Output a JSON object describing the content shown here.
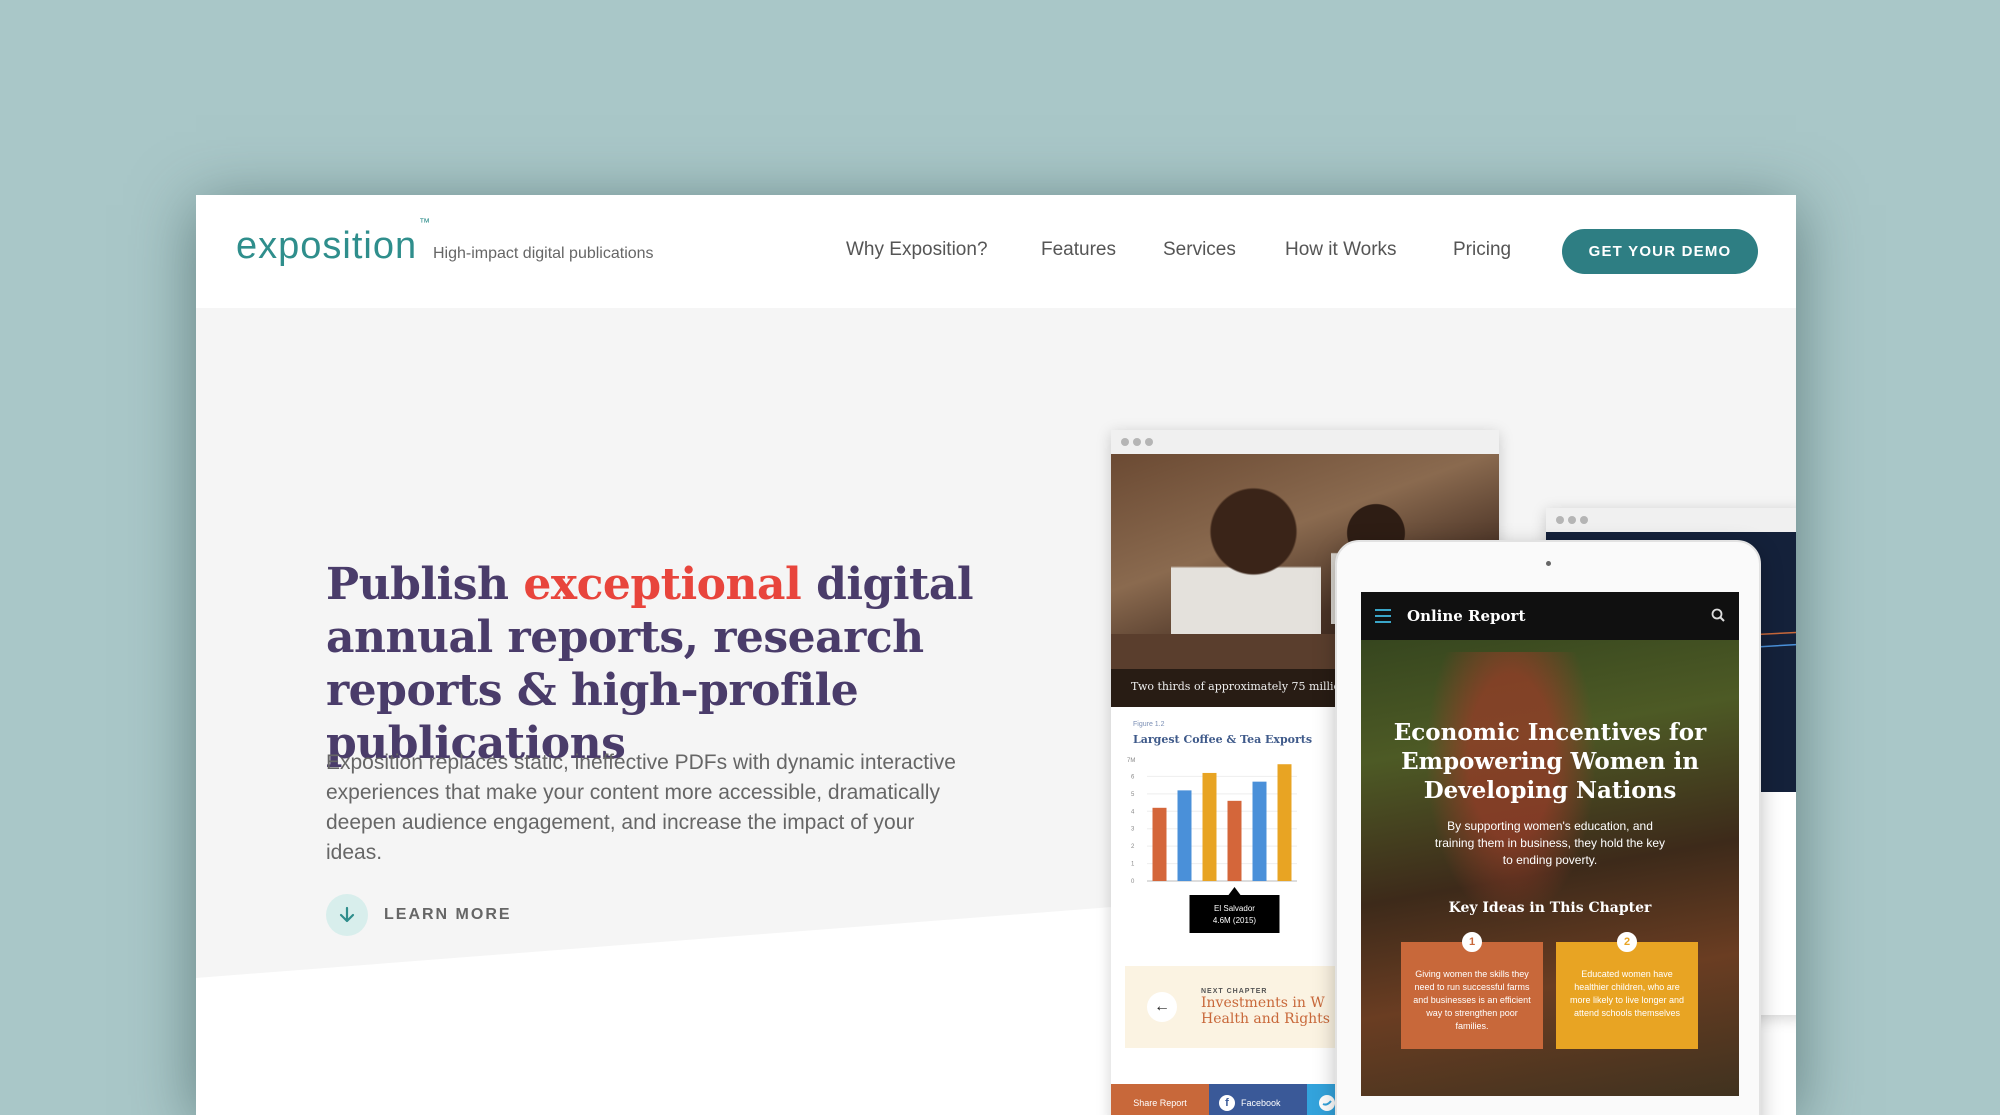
{
  "brand": {
    "logo": "exposition",
    "trademark": "™",
    "tagline": "High-impact digital publications"
  },
  "nav": {
    "items": [
      "Why Exposition?",
      "Features",
      "Services",
      "How it Works",
      "Pricing"
    ],
    "cta": "GET YOUR DEMO"
  },
  "hero": {
    "headline_before": "Publish ",
    "headline_accent": "exceptional",
    "headline_after": " digital annual reports, research reports & high-profile publications",
    "lead": "Exposition replaces static, ineffective PDFs with dynamic interactive experiences that make your content more accessible, dramatically deepen audience engagement, and increase the impact of your ideas.",
    "learn_more": "LEARN MORE"
  },
  "browser_mock": {
    "photo_caption": "Two thirds of approximately 75 million",
    "figure_label": "Figure 1.2",
    "figure_title": "Largest Coffee & Tea Exports",
    "tooltip_line1": "El Salvador",
    "tooltip_line2": "4.6M (2015)",
    "next_chapter_label": "NEXT CHAPTER",
    "next_chapter_line1": "Investments in W",
    "next_chapter_line2": "Health and Rights",
    "share_label": "Share Report",
    "facebook_label": "Facebook"
  },
  "chart_data": {
    "type": "bar",
    "title": "Largest Coffee & Tea Exports",
    "ylabel": "",
    "ylim": [
      0,
      7
    ],
    "yticks": [
      "0",
      "1",
      "2",
      "3",
      "4",
      "5",
      "6"
    ],
    "ytop_label": "7M",
    "series_colors": [
      "#d4663a",
      "#4a90d9",
      "#e8a423",
      "#d4663a",
      "#4a90d9",
      "#e8a423"
    ],
    "values": [
      4.2,
      5.2,
      6.2,
      4.6,
      5.7,
      6.7
    ]
  },
  "tablet_mock": {
    "bar_title": "Online Report",
    "headline": "Economic Incentives for Empowering Women in Developing Nations",
    "subtitle": "By supporting women's education, and training them in business, they hold the key to ending poverty.",
    "key_ideas_title": "Key Ideas in This Chapter",
    "cards": [
      {
        "num": "1",
        "text": "Giving women the skills they need to run successful farms and businesses is an efficient way to strengthen poor families.",
        "color": "#c8683a"
      },
      {
        "num": "2",
        "text": "Educated women have healthier children, who are more likely to live longer and attend schools themselves",
        "color": "#e8a423"
      }
    ]
  },
  "colors": {
    "background": "#a9c7c8",
    "brand_teal": "#2f8e8c",
    "cta_button": "#2e7e83",
    "headline": "#4a3c6a",
    "accent_red": "#e8453c"
  }
}
